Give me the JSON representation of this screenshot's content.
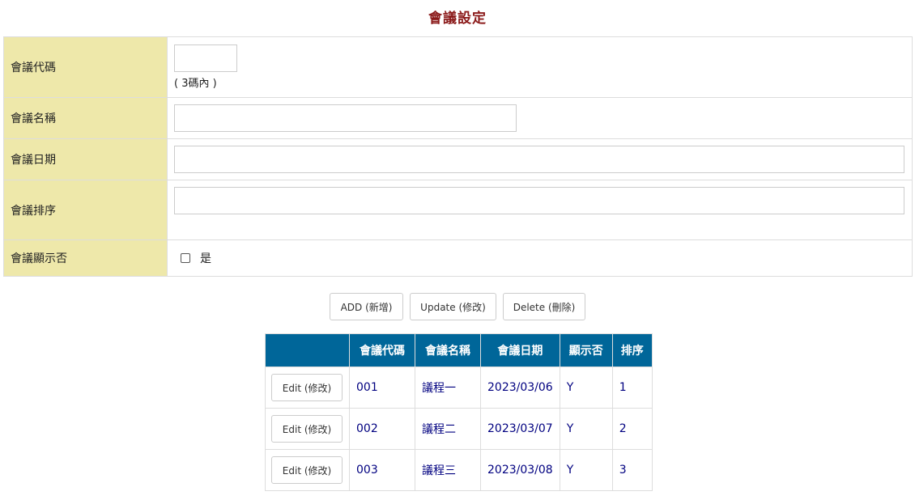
{
  "page": {
    "title": "會議設定"
  },
  "form": {
    "code_label": "會議代碼",
    "code_value": "",
    "code_hint": "( 3碼內 )",
    "name_label": "會議名稱",
    "name_value": "",
    "date_label": "會議日期",
    "date_value": "",
    "order_label": "會議排序",
    "order_value": "",
    "display_label": "會議顯示否",
    "display_checked": false,
    "display_option": "是"
  },
  "buttons": {
    "add": "ADD (新增)",
    "update": "Update (修改)",
    "delete": "Delete (刪除)"
  },
  "grid": {
    "headers": [
      "",
      "會議代碼",
      "會議名稱",
      "會議日期",
      "顯示否",
      "排序"
    ],
    "edit_label": "Edit (修改)",
    "rows": [
      {
        "code": "001",
        "name": "議程一",
        "date": "2023/03/06",
        "display": "Y",
        "order": "1"
      },
      {
        "code": "002",
        "name": "議程二",
        "date": "2023/03/07",
        "display": "Y",
        "order": "2"
      },
      {
        "code": "003",
        "name": "議程三",
        "date": "2023/03/08",
        "display": "Y",
        "order": "3"
      }
    ]
  },
  "colors": {
    "title": "#8b1a1a",
    "label_bg": "#eee8aa",
    "grid_header_bg": "#006699",
    "grid_text": "#000080"
  }
}
